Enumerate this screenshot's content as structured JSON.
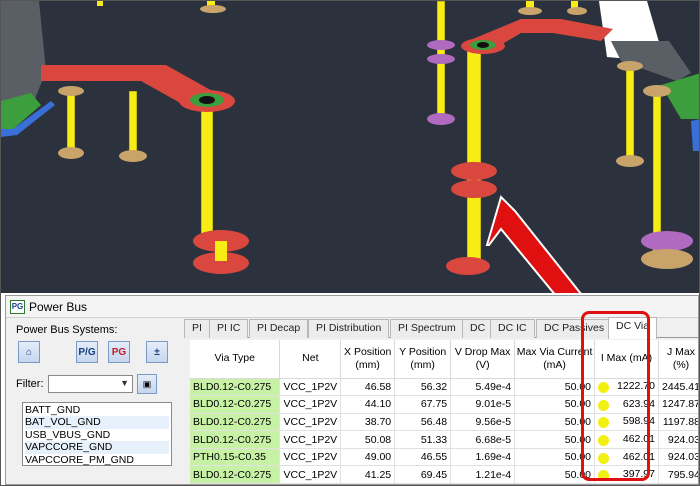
{
  "panel": {
    "logo_text": "PG",
    "title": "Power Bus"
  },
  "left_pane": {
    "systems_label": "Power Bus Systems:",
    "filter_label": "Filter:",
    "filter_value": "",
    "tool_buttons": [
      {
        "name": "home-icon",
        "glyph": "⌂"
      },
      {
        "name": "pg-icon",
        "glyph": "P/G"
      },
      {
        "name": "pg-red-icon",
        "glyph": "PG"
      },
      {
        "name": "plus-minus-icon",
        "glyph": "±"
      }
    ],
    "power_bus_systems": [
      "BATT_GND",
      "BAT_VOL_GND",
      "USB_VBUS_GND",
      "VAPCCORE_GND",
      "VAPCCORE_PM_GND"
    ]
  },
  "tabs": [
    "PI",
    "PI IC",
    "PI Decap",
    "PI Distribution",
    "PI Spectrum",
    "DC",
    "DC IC",
    "DC Passives",
    "DC Via"
  ],
  "active_tab": "DC Via",
  "table": {
    "columns": [
      "Via Type",
      "Net",
      "X Position (mm)",
      "Y Position (mm)",
      "V Drop Max (V)",
      "Max Via Current (mA)",
      "I Max (mA)",
      "J Max (%)"
    ],
    "rows": [
      [
        "BLD0.12-C0.275",
        "VCC_1P2V",
        "46.58",
        "56.32",
        "5.49e-4",
        "50.00",
        "1222.70",
        "2445.41"
      ],
      [
        "BLD0.12-C0.275",
        "VCC_1P2V",
        "44.10",
        "67.75",
        "9.01e-5",
        "50.00",
        "623.94",
        "1247.87"
      ],
      [
        "BLD0.12-C0.275",
        "VCC_1P2V",
        "38.70",
        "56.48",
        "9.56e-5",
        "50.00",
        "598.94",
        "1197.88"
      ],
      [
        "BLD0.12-C0.275",
        "VCC_1P2V",
        "50.08",
        "51.33",
        "6.68e-5",
        "50.00",
        "462.01",
        "924.03"
      ],
      [
        "PTH0.15-C0.35",
        "VCC_1P2V",
        "49.00",
        "46.55",
        "1.69e-4",
        "50.00",
        "462.01",
        "924.03"
      ],
      [
        "BLD0.12-C0.275",
        "VCC_1P2V",
        "41.25",
        "69.45",
        "1.21e-4",
        "50.00",
        "397.97",
        "795.94"
      ]
    ]
  },
  "colors": {
    "viewport_bg": "#2c323d",
    "via_barrel": "#f7ec14",
    "pad_red": "#d9473f",
    "pad_tan": "#c9a46a",
    "pad_purple": "#b06bc0",
    "trace_red": "#d9473f",
    "via_type_cell": "#c7f1a4",
    "status_dot": "#f2ef12",
    "callout": "#e01010"
  }
}
